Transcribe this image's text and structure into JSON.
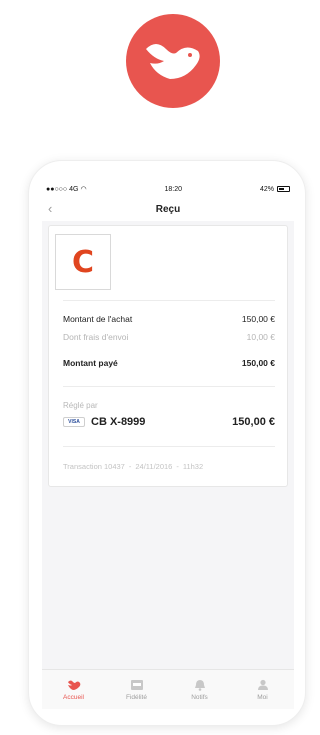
{
  "status_bar": {
    "carrier": "●●○○○ 4G",
    "time": "18:20",
    "battery": "42%"
  },
  "navbar": {
    "title": "Reçu",
    "back_icon": "chevron-left-icon"
  },
  "receipt": {
    "merchant_initial": "C",
    "rows": [
      {
        "label": "Montant de l'achat",
        "value": "150,00 €"
      },
      {
        "label": "Dont frais d'envoi",
        "value": "10,00 €"
      },
      {
        "label": "Montant payé",
        "value": "150,00 €"
      }
    ],
    "paid_by_label": "Réglé par",
    "card_brand": "VISA",
    "card_label": "CB X-8999",
    "card_amount": "150,00 €",
    "transaction": {
      "id": "Transaction 10437",
      "date": "24/11/2016",
      "time": "11h32",
      "separator": "-"
    }
  },
  "tabbar": {
    "items": [
      {
        "label": "Accueil",
        "icon": "bird-icon",
        "active": true
      },
      {
        "label": "Fidélité",
        "icon": "card-icon",
        "active": false
      },
      {
        "label": "Notifs",
        "icon": "bell-icon",
        "active": false
      },
      {
        "label": "Moi",
        "icon": "user-icon",
        "active": false
      }
    ]
  },
  "colors": {
    "brand": "#e8554f",
    "merchant": "#e0451f"
  }
}
